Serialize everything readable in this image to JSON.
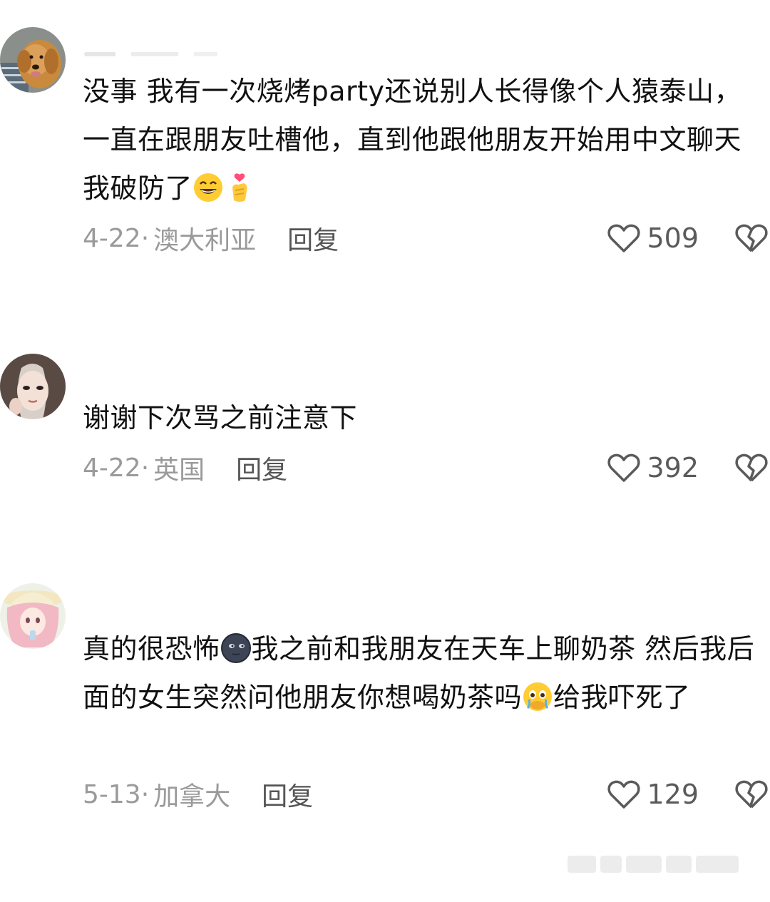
{
  "comments": [
    {
      "text_before_emoji": "没事 我有一次烧烤party还说别人长得像个人猿泰山，一直在跟朋友吐槽他，直到他跟他朋友开始用中文聊天 我破防了",
      "emojis": [
        "grinning-sweat-emoji",
        "finger-heart-emoji"
      ],
      "date": "4-22",
      "location": "澳大利亚",
      "reply_label": "回复",
      "likes": "509"
    },
    {
      "text_before_emoji": "谢谢下次骂之前注意下",
      "date": "4-22",
      "location": "英国",
      "reply_label": "回复",
      "likes": "392"
    },
    {
      "text_part1": "真的很恐怖",
      "emoji1": "new-moon-face-emoji",
      "text_part2": "我之前和我朋友在天车上聊奶茶 然后我后面的女生突然问他朋友你想喝奶茶吗",
      "emoji2": "holding-back-tears-emoji",
      "text_part3": "给我吓死了",
      "date": "5-13",
      "location": "加拿大",
      "reply_label": "回复",
      "likes": "129"
    }
  ],
  "meta_separator": "·",
  "colors": {
    "text": "#111111",
    "meta": "#9a9a9a",
    "reply": "#555555",
    "icon": "#5a5a5a"
  }
}
